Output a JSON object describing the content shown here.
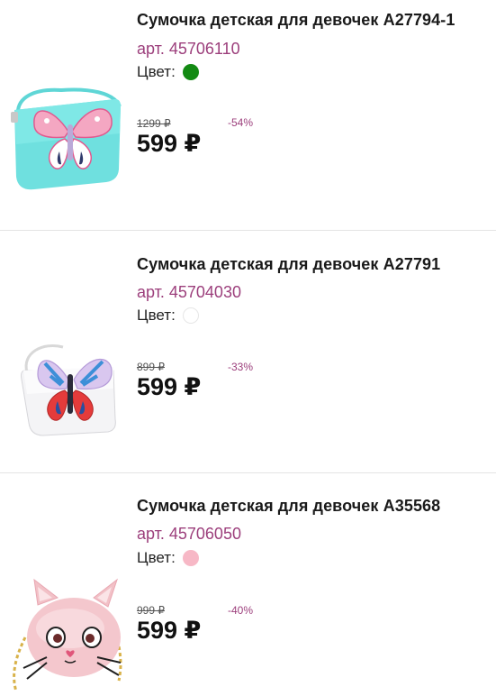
{
  "products": [
    {
      "title": "Сумочка детская для девочек A27794-1",
      "sku": "арт. 45706110",
      "color_label": "Цвет:",
      "color_swatch": "#138a13",
      "old_price": "1299 ₽",
      "discount": "-54%",
      "price": "599 ₽",
      "image_icon": "butterfly-bag-turquoise-icon"
    },
    {
      "title": "Сумочка детская для девочек A27791",
      "sku": "арт. 45704030",
      "color_label": "Цвет:",
      "color_swatch": "#ffffff",
      "old_price": "899 ₽",
      "discount": "-33%",
      "price": "599 ₽",
      "image_icon": "butterfly-bag-white-icon"
    },
    {
      "title": "Сумочка детская для девочек A35568",
      "sku": "арт. 45706050",
      "color_label": "Цвет:",
      "color_swatch": "#f7b8c6",
      "old_price": "999 ₽",
      "discount": "-40%",
      "price": "599 ₽",
      "image_icon": "cat-bag-pink-icon"
    }
  ],
  "colors": {
    "accent": "#9c3f7c",
    "divider": "#e4e4e4",
    "text": "#111111"
  }
}
